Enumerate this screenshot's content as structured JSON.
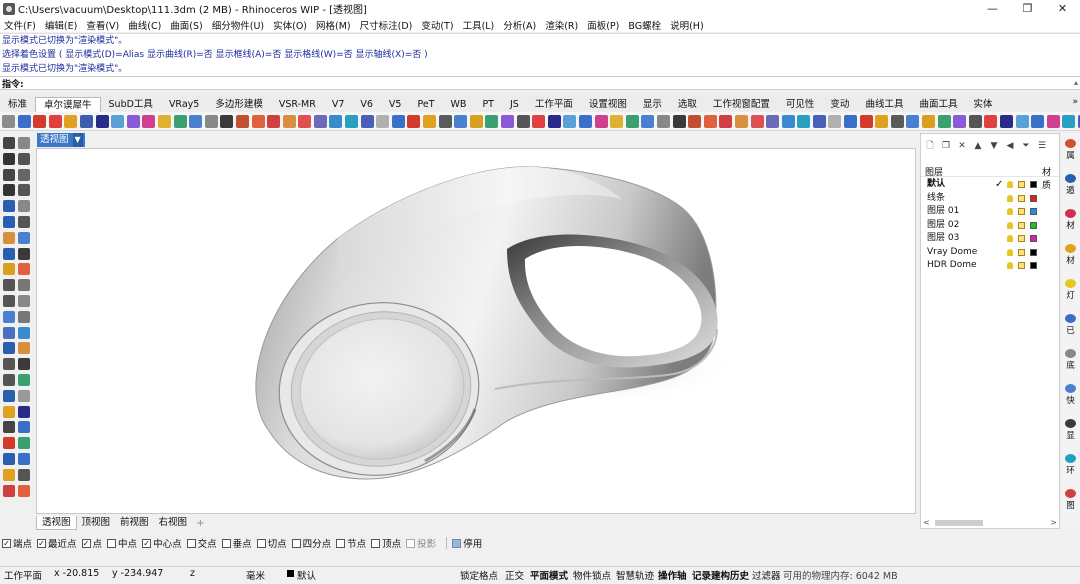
{
  "window": {
    "title": "C:\\Users\\vacuum\\Desktop\\111.3dm (2 MB) - Rhinoceros WIP - [透视图]",
    "controls": [
      "—",
      "❐",
      "✕"
    ]
  },
  "menu": [
    "文件(F)",
    "编辑(E)",
    "查看(V)",
    "曲线(C)",
    "曲面(S)",
    "细分物件(U)",
    "实体(O)",
    "网格(M)",
    "尺寸标注(D)",
    "变动(T)",
    "工具(L)",
    "分析(A)",
    "渲染(R)",
    "面板(P)",
    "BG螺栓",
    "说明(H)"
  ],
  "command_history": [
    "显示模式已切换为\"渲染模式\"。",
    "选择着色设置 ( 显示模式(D)=Alias  显示曲线(R)=否  显示框线(A)=否  显示格线(W)=否  显示轴线(X)=否 )",
    "显示模式已切换为\"渲染模式\"。"
  ],
  "command_prompt": "指令:",
  "toolbar_tabs": [
    "标准",
    "卓尔谟犀牛",
    "SubD工具",
    "VRay5",
    "多边形建模",
    "VSR-MR",
    "V7",
    "V6",
    "V5",
    "PeT",
    "WB",
    "PT",
    "JS",
    "工作平面",
    "设置视图",
    "显示",
    "选取",
    "工作视窗配置",
    "可见性",
    "变动",
    "曲线工具",
    "曲面工具",
    "实体"
  ],
  "active_tab": "卓尔谟犀牛",
  "toolbar_icon_colors": [
    "#8c8c8c",
    "#3a6fc9",
    "#d23a2a",
    "#e04040",
    "#e0a020",
    "#3a5fb0",
    "#2a2a8a",
    "#5aa0d8",
    "#8a5ad8",
    "#d04090",
    "#e0b030",
    "#3aa070",
    "#4a80d0",
    "#888888",
    "#3a3a3a",
    "#c05030",
    "#e06040",
    "#d04040",
    "#d89040",
    "#e05050",
    "#6a6ab8",
    "#3a8ad0",
    "#2aa0c0",
    "#4a60b8",
    "#b0b0b0",
    "#3a6fc9",
    "#d23a2a",
    "#e0a020",
    "#5a5a5a",
    "#4a80d0",
    "#d8a020",
    "#3aa070",
    "#8a5ad8",
    "#555555",
    "#e04040",
    "#2a2a8a",
    "#5aa0d8",
    "#3a6fc9",
    "#d04090",
    "#e0b030",
    "#3aa070",
    "#4a80d0",
    "#888888",
    "#3a3a3a",
    "#c05030",
    "#e06040",
    "#d04040",
    "#d89040",
    "#e05050",
    "#6a6ab8",
    "#3a8ad0",
    "#2aa0c0",
    "#4a60b8",
    "#b0b0b0",
    "#3a6fc9",
    "#d23a2a",
    "#e0a020",
    "#5a5a5a",
    "#4a80d0",
    "#d8a020",
    "#3aa070",
    "#8a5ad8",
    "#555555",
    "#e04040",
    "#2a2a8a",
    "#5aa0d8",
    "#3a6fc9",
    "#d04090",
    "#2aa0c0",
    "#4a60b8",
    "#e0a020",
    "#888888"
  ],
  "left_tool_colors": [
    "#444444",
    "#888888",
    "#333333",
    "#555555",
    "#444444",
    "#666666",
    "#333333",
    "#555555",
    "#2a5fb0",
    "#888888",
    "#2a5fb0",
    "#555555",
    "#d89040",
    "#4a80d0",
    "#2a5fb0",
    "#3a3a3a",
    "#d8a020",
    "#e06040",
    "#555555",
    "#777777",
    "#555555",
    "#888888",
    "#4a80d0",
    "#777777",
    "#4a70c0",
    "#3a8ad0",
    "#2a5fb0",
    "#d89040",
    "#555555",
    "#3a3a3a",
    "#555555",
    "#3aa070",
    "#2a5fb0",
    "#999999",
    "#e0a020",
    "#2a2a8a",
    "#444444",
    "#3a6fc9",
    "#d23a2a",
    "#3aa070",
    "#2a5fb0",
    "#3a6fc9",
    "#e0a020",
    "#555555",
    "#d04040",
    "#e06040"
  ],
  "viewport": {
    "label": "透视图",
    "dropdown": "▼",
    "tabs": [
      "透视图",
      "顶视图",
      "前视图",
      "右视图"
    ],
    "active_tab": "透视图",
    "add_tab": "+"
  },
  "layers_panel": {
    "header_layer": "图层",
    "header_material": "材质",
    "toolbar": [
      "🗋",
      "❐",
      "✕",
      "▲",
      "▼",
      "◀",
      "⏷",
      "☰"
    ],
    "rows": [
      {
        "name": "默认",
        "current": true,
        "color": "#000000",
        "bold": true
      },
      {
        "name": "线条",
        "current": false,
        "color": "#e02020",
        "bold": false
      },
      {
        "name": "图层 01",
        "current": false,
        "color": "#2090e0",
        "bold": false
      },
      {
        "name": "图层 02",
        "current": false,
        "color": "#20c020",
        "bold": false
      },
      {
        "name": "图层 03",
        "current": false,
        "color": "#e020a0",
        "bold": false
      },
      {
        "name": "Vray Dome",
        "current": false,
        "color": "#000000",
        "bold": false
      },
      {
        "name": "HDR Dome",
        "current": false,
        "color": "#000000",
        "bold": false
      }
    ],
    "current_mark": "✓",
    "scroll_left": "<",
    "scroll_right": ">"
  },
  "right_panel_tabs": [
    {
      "label": "属",
      "icon_color": "#d05030"
    },
    {
      "label": "遁",
      "icon_color": "#2a5fb0"
    },
    {
      "label": "材",
      "icon_color": "#d03050"
    },
    {
      "label": "材",
      "icon_color": "#e0a020"
    },
    {
      "label": "灯",
      "icon_color": "#e8c520"
    },
    {
      "label": "已",
      "icon_color": "#3a6fc9"
    },
    {
      "label": "底",
      "icon_color": "#888888"
    },
    {
      "label": "快",
      "icon_color": "#4a80d0"
    },
    {
      "label": "显",
      "icon_color": "#3a3a3a"
    },
    {
      "label": "环",
      "icon_color": "#20a0c0"
    },
    {
      "label": "图",
      "icon_color": "#d04040"
    }
  ],
  "osnaps": [
    {
      "label": "端点",
      "checked": true,
      "enabled": true
    },
    {
      "label": "最近点",
      "checked": true,
      "enabled": true
    },
    {
      "label": "点",
      "checked": true,
      "enabled": true
    },
    {
      "label": "中点",
      "checked": false,
      "enabled": true
    },
    {
      "label": "中心点",
      "checked": true,
      "enabled": true
    },
    {
      "label": "交点",
      "checked": false,
      "enabled": true
    },
    {
      "label": "垂点",
      "checked": false,
      "enabled": true
    },
    {
      "label": "切点",
      "checked": false,
      "enabled": true
    },
    {
      "label": "四分点",
      "checked": false,
      "enabled": true
    },
    {
      "label": "节点",
      "checked": false,
      "enabled": true
    },
    {
      "label": "顶点",
      "checked": false,
      "enabled": true
    },
    {
      "label": "投影",
      "checked": false,
      "enabled": false
    },
    {
      "label": "停用",
      "checked": false,
      "enabled": true
    }
  ],
  "status": {
    "cplane": "工作平面",
    "x": "x -20.815",
    "y": "y -234.947",
    "z": "z",
    "units": "毫米",
    "layer": "默认",
    "grid_snap": "锁定格点",
    "ortho": "正交",
    "planar": "平面模式",
    "osnap": "物件锁点",
    "smarttrack": "智慧轨迹",
    "gumball": "操作轴",
    "history": "记录建构历史",
    "filter": "过滤器",
    "memory": "可用的物理内存: 6042 MB"
  }
}
